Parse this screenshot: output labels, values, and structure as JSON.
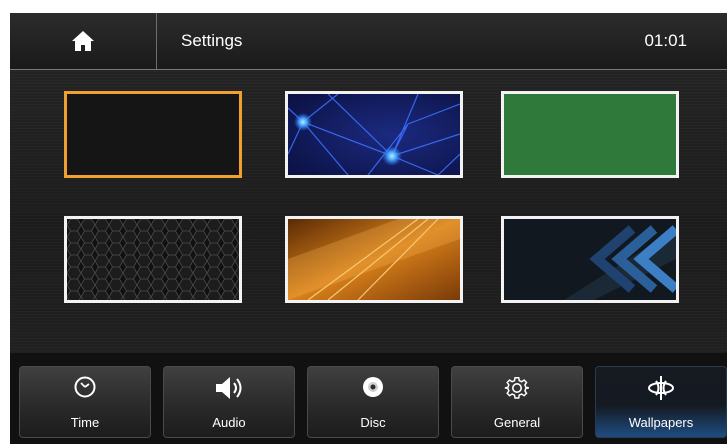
{
  "header": {
    "title": "Settings",
    "time": "01:01",
    "home_icon": "home-icon"
  },
  "wallpapers": [
    {
      "id": "black",
      "selected": true,
      "style": "solid-black"
    },
    {
      "id": "network",
      "selected": false,
      "style": "blue-network"
    },
    {
      "id": "green",
      "selected": false,
      "style": "solid-green"
    },
    {
      "id": "hexagon",
      "selected": false,
      "style": "dark-hexagon"
    },
    {
      "id": "amber",
      "selected": false,
      "style": "amber-waves"
    },
    {
      "id": "chevron",
      "selected": false,
      "style": "blue-chevrons"
    }
  ],
  "tabs": [
    {
      "label": "Time",
      "icon": "clock-icon",
      "active": false
    },
    {
      "label": "Audio",
      "icon": "speaker-icon",
      "active": false
    },
    {
      "label": "Disc",
      "icon": "disc-icon",
      "active": false
    },
    {
      "label": "General",
      "icon": "gear-icon",
      "active": false
    },
    {
      "label": "Wallpapers",
      "icon": "wallpaper-icon",
      "active": true
    }
  ],
  "colors": {
    "selected_border": "#f0a030",
    "active_tab": "#1f4d82",
    "frame_border": "#f2f2f2"
  }
}
